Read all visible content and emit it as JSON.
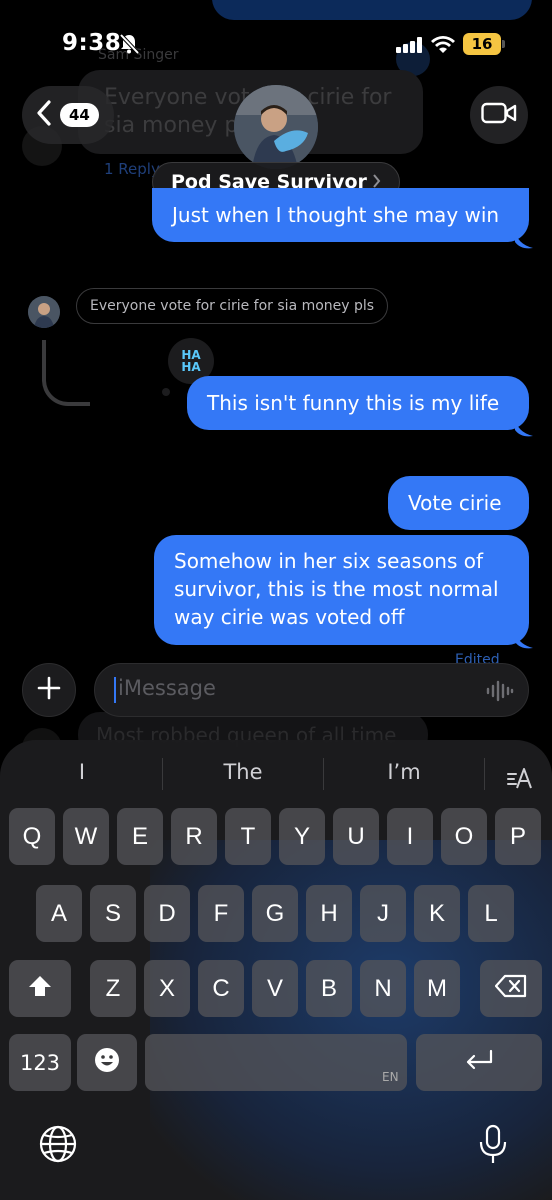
{
  "status_bar": {
    "time": "9:38",
    "battery": "16"
  },
  "header": {
    "back_count": "44",
    "group_name": "Pod Save Survivor"
  },
  "background_thread": {
    "sender": "Sam Singer",
    "message": "Everyone vote for cirie for sia money pls",
    "replies": "1 Reply",
    "lower_message": "Most robbed queen of all time"
  },
  "messages": [
    {
      "id": "msg1",
      "text": "Just when I thought she may win"
    },
    {
      "id": "msg2",
      "text": "This isn't funny this is my life",
      "reaction": "HAHA"
    },
    {
      "id": "msg3",
      "text": "Vote cirie"
    },
    {
      "id": "msg4",
      "text": "Somehow in her six seasons of survivor, this is the most normal way cirie was voted off",
      "status": "Edited"
    }
  ],
  "reply_quote": "Everyone vote for cirie for sia money pls",
  "reaction_text": {
    "line1": "HA",
    "line2": "HA"
  },
  "compose": {
    "placeholder": "iMessage"
  },
  "keyboard": {
    "suggestions": [
      "I",
      "The",
      "I’m"
    ],
    "row1": [
      "Q",
      "W",
      "E",
      "R",
      "T",
      "Y",
      "U",
      "I",
      "O",
      "P"
    ],
    "row2": [
      "A",
      "S",
      "D",
      "F",
      "G",
      "H",
      "J",
      "K",
      "L"
    ],
    "row3": [
      "Z",
      "X",
      "C",
      "V",
      "B",
      "N",
      "M"
    ],
    "numbers_key": "123",
    "space_lang": "EN"
  },
  "colors": {
    "bubble_blue": "#3478f6",
    "background": "#000000"
  }
}
